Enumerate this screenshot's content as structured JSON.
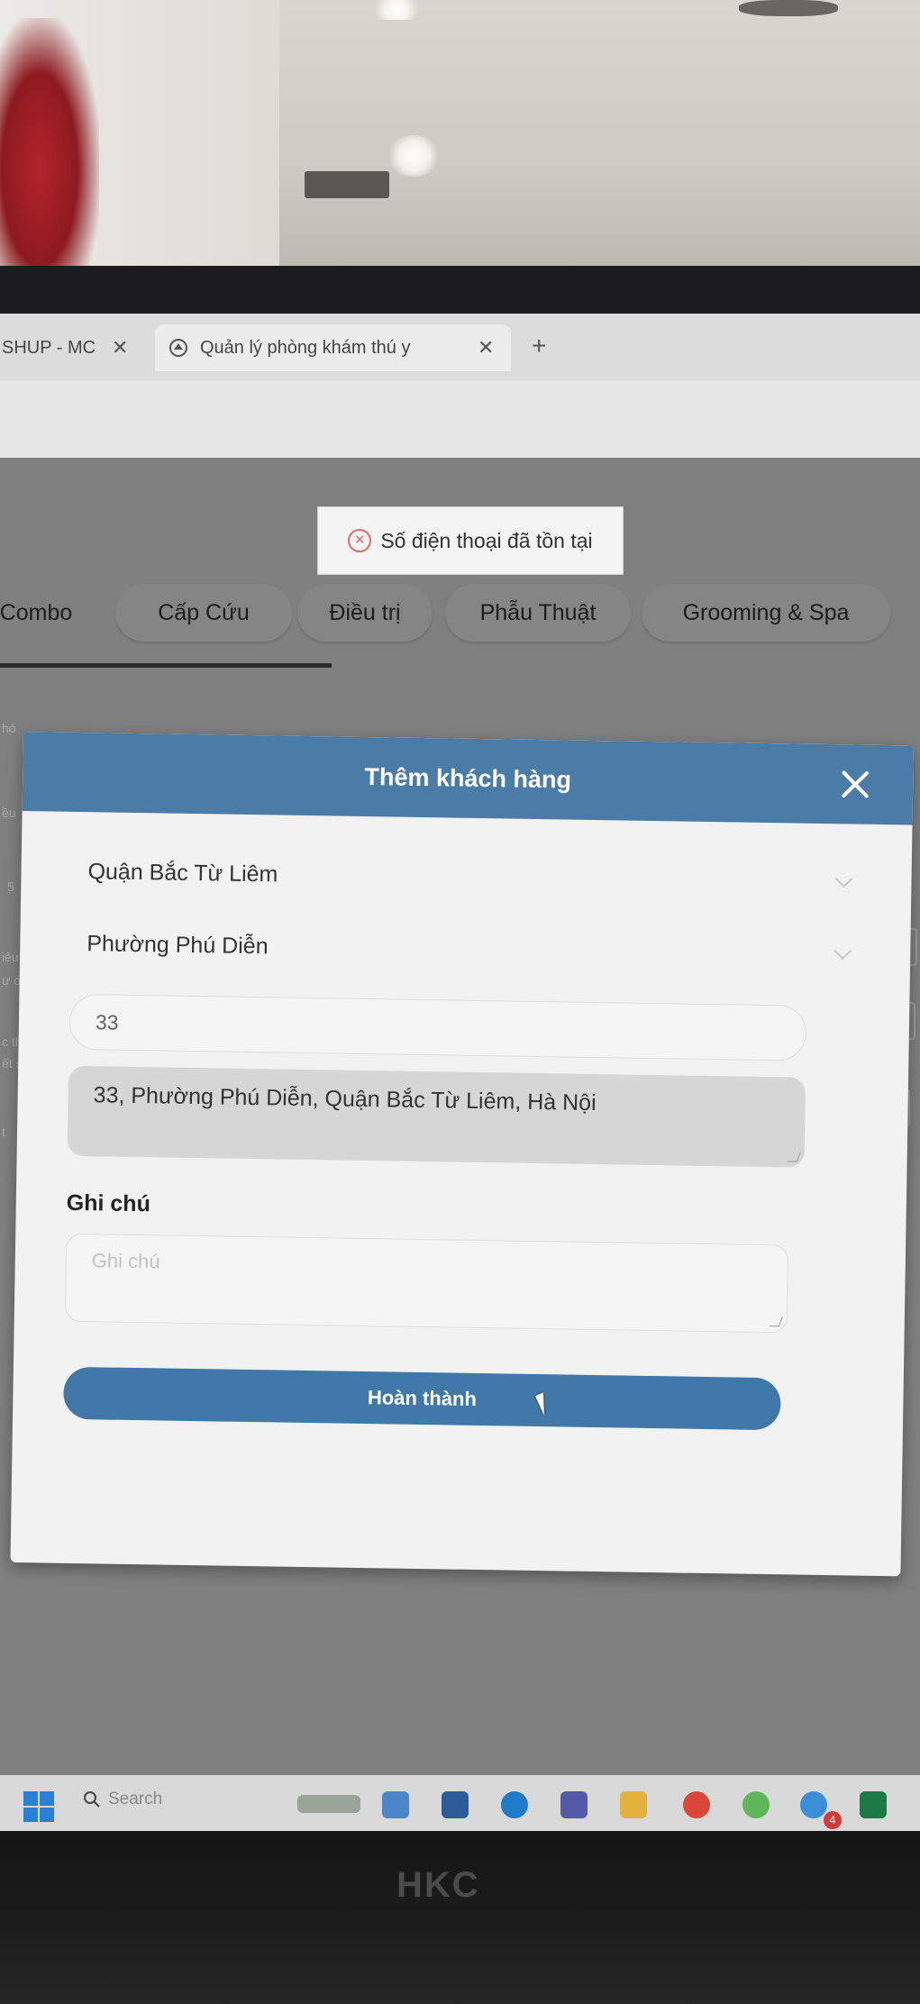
{
  "browser": {
    "tabs": [
      {
        "label": "SHUP - MC"
      },
      {
        "label": "Quản lý phòng khám thú y"
      }
    ],
    "new_tab_label": "+"
  },
  "toast": {
    "message": "Số điện thoại đã tồn tại"
  },
  "categories": [
    "Combo",
    "Cấp Cứu",
    "Điều trị",
    "Phẫu Thuật",
    "Grooming & Spa"
  ],
  "background_fragments": [
    "hó",
    "ều",
    "5",
    "iêu",
    "ư ơn",
    "c th",
    "ết s",
    "t"
  ],
  "modal": {
    "title": "Thêm khách hàng",
    "district": "Quận Bắc Từ Liêm",
    "ward": "Phường Phú Diễn",
    "street_value": "33",
    "full_address": "33, Phường Phú Diễn, Quận Bắc Từ Liêm, Hà Nội",
    "note_label": "Ghi chú",
    "note_placeholder": "Ghi chú",
    "submit_label": "Hoàn thành"
  },
  "taskbar": {
    "search_label": "Search",
    "notification_count": "4"
  },
  "monitor_brand": "HKC",
  "colors": {
    "modal_header": "#4b7ca8",
    "submit_button": "#4178aa",
    "error": "#e06c6c"
  }
}
